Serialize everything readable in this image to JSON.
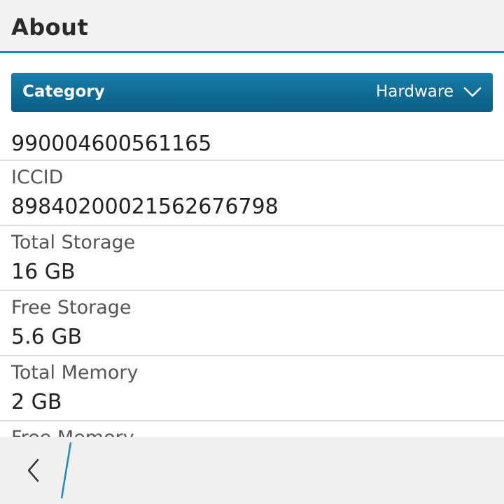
{
  "header": {
    "title": "About"
  },
  "category": {
    "label": "Category",
    "value": "Hardware"
  },
  "rows": [
    {
      "label": "",
      "value": "990004600561165"
    },
    {
      "label": "ICCID",
      "value": "89840200021562676798"
    },
    {
      "label": "Total Storage",
      "value": "16 GB"
    },
    {
      "label": "Free Storage",
      "value": "5.6 GB"
    },
    {
      "label": "Total Memory",
      "value": "2 GB"
    },
    {
      "label": "Free Memory",
      "value": ""
    }
  ],
  "icons": {
    "dropdown": "chevron-down-icon",
    "back": "chevron-left-icon"
  },
  "colors": {
    "accent": "#1a8ab8",
    "dropdown_bg": "#0e6a93"
  }
}
